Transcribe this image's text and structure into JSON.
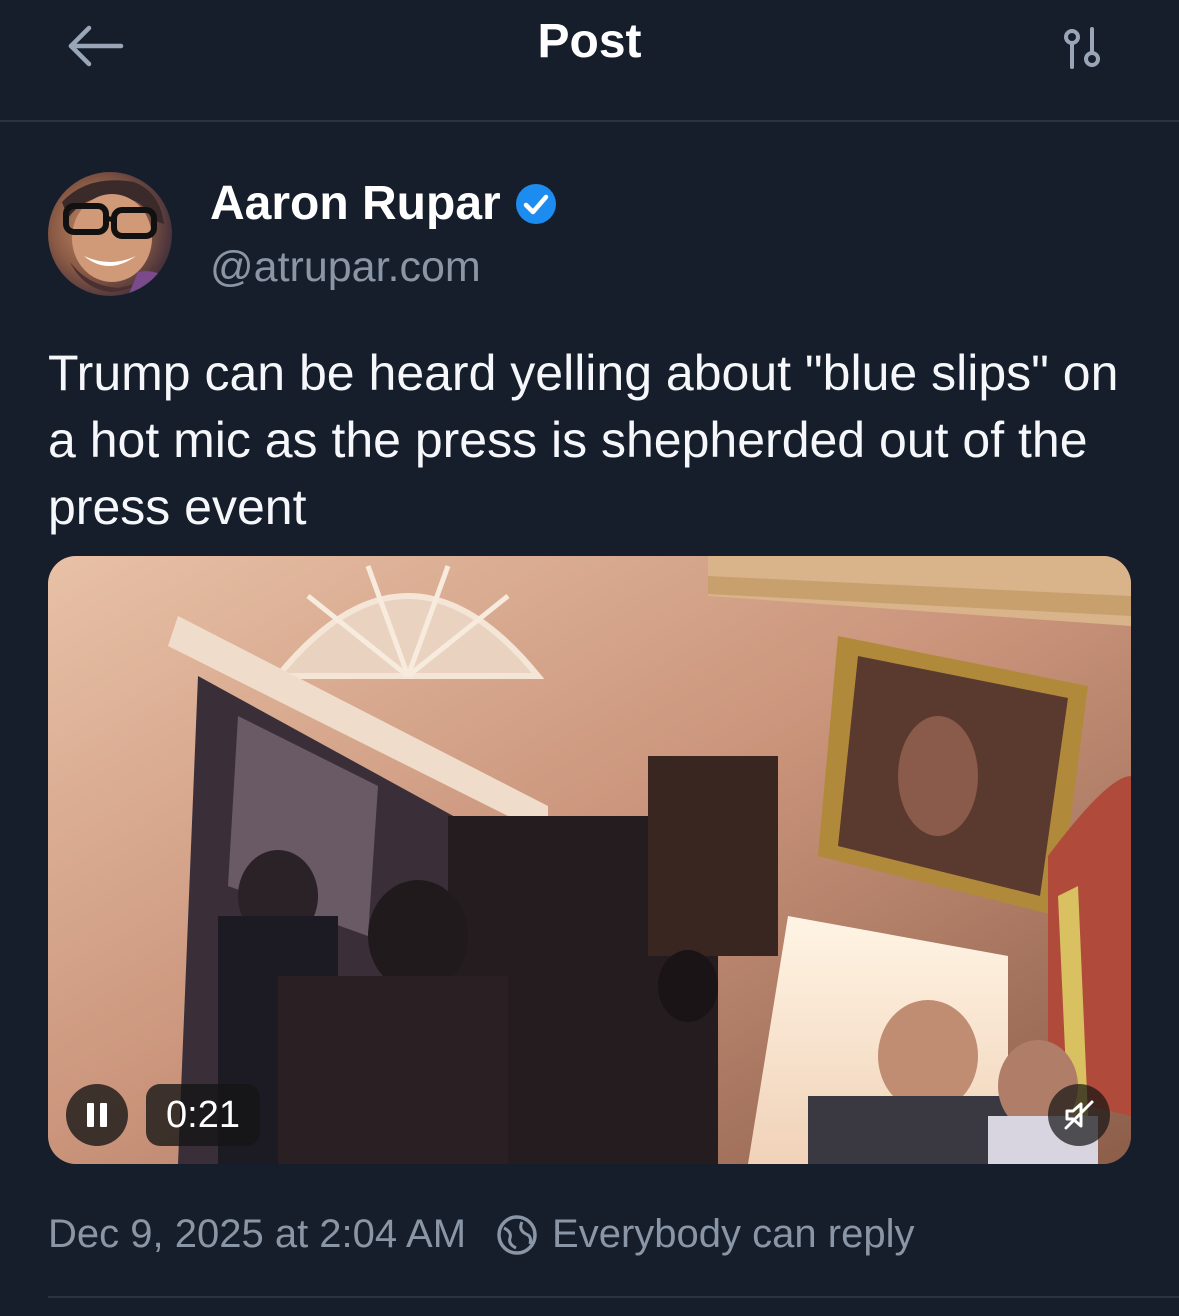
{
  "header": {
    "title": "Post",
    "back_icon": "arrow-left-icon",
    "settings_icon": "sliders-icon"
  },
  "author": {
    "display_name": "Aaron Rupar",
    "handle": "@atrupar.com",
    "verified_icon": "verified-check-icon",
    "verified_color": "#1d8cf0"
  },
  "post": {
    "text": "Trump can be heard yelling about \"blue slips\" on a hot mic as the press is shepherded out of the press event"
  },
  "video": {
    "time": "0:21",
    "state_icon": "pause-icon",
    "mute_icon": "muted-speaker-icon"
  },
  "meta": {
    "timestamp": "Dec 9, 2025 at 2:04 AM",
    "reply_setting": "Everybody can reply",
    "reply_icon": "globe-icon"
  },
  "colors": {
    "background": "#161e2b",
    "divider": "#2a3444",
    "secondary_text": "#8a95a6"
  }
}
